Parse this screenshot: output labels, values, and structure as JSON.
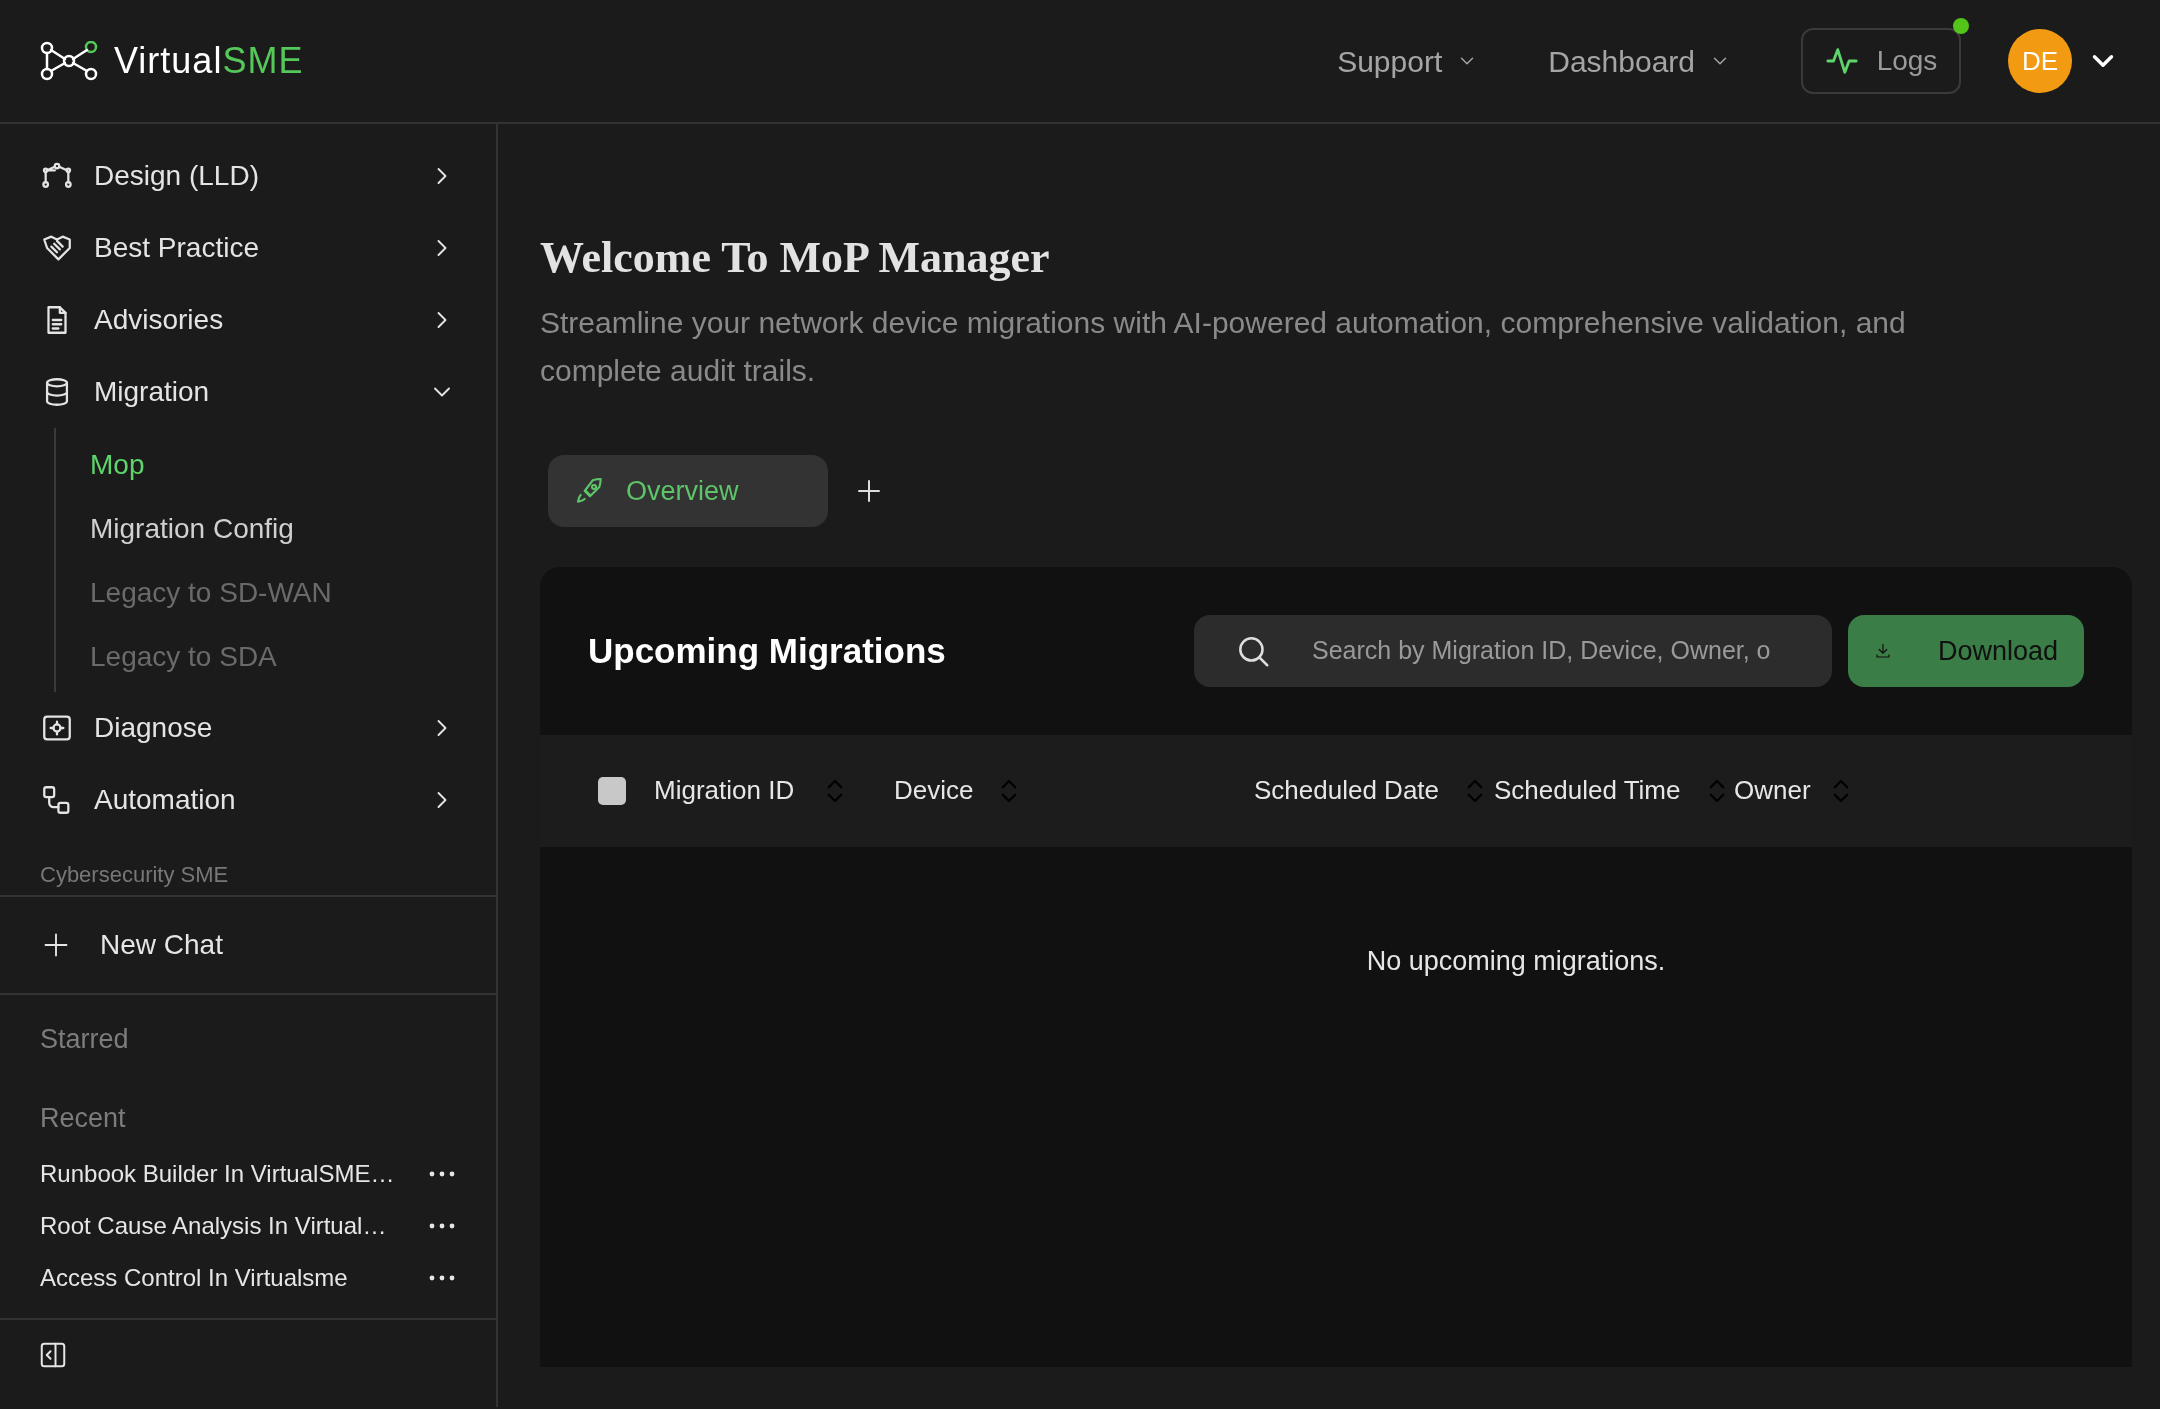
{
  "header": {
    "logo": {
      "text": "Virtual",
      "accent": "SME"
    },
    "nav": [
      {
        "label": "Support"
      },
      {
        "label": "Dashboard"
      }
    ],
    "logs": {
      "label": "Logs",
      "notification": true
    },
    "avatar": {
      "initials": "DE"
    }
  },
  "sidebar": {
    "items": [
      {
        "label": "Design (LLD)",
        "expanded": false
      },
      {
        "label": "Best Practice",
        "expanded": false
      },
      {
        "label": "Advisories",
        "expanded": false
      },
      {
        "label": "Migration",
        "expanded": true,
        "children": [
          {
            "label": "Mop",
            "selected": true,
            "disabled": false
          },
          {
            "label": "Migration Config",
            "selected": false,
            "disabled": false
          },
          {
            "label": "Legacy to SD-WAN",
            "selected": false,
            "disabled": true
          },
          {
            "label": "Legacy to SDA",
            "selected": false,
            "disabled": true
          }
        ]
      },
      {
        "label": "Diagnose",
        "expanded": false
      },
      {
        "label": "Automation",
        "expanded": false
      }
    ],
    "section_label": "Cybersecurity SME",
    "new_chat": "New Chat",
    "starred": {
      "heading": "Starred"
    },
    "recent": {
      "heading": "Recent",
      "items": [
        {
          "title": "Runbook Builder In VirtualSME…"
        },
        {
          "title": "Root Cause Analysis In Virtual…"
        },
        {
          "title": "Access Control In Virtualsme"
        }
      ]
    }
  },
  "main": {
    "title": "Welcome To MoP Manager",
    "description": "Streamline your network device migrations with AI-powered automation, comprehensive validation, and complete audit trails.",
    "tabs": [
      {
        "label": "Overview",
        "selected": true
      }
    ],
    "card": {
      "title": "Upcoming Migrations",
      "search": {
        "placeholder": "Search by Migration ID, Device, Owner, o"
      },
      "download": "Download",
      "select_all": {
        "checked": false
      },
      "columns": [
        {
          "label": "Migration ID"
        },
        {
          "label": "Device"
        },
        {
          "label": "Scheduled Date"
        },
        {
          "label": "Scheduled Time"
        },
        {
          "label": "Owner"
        }
      ],
      "empty_message": "No upcoming migrations."
    }
  }
}
